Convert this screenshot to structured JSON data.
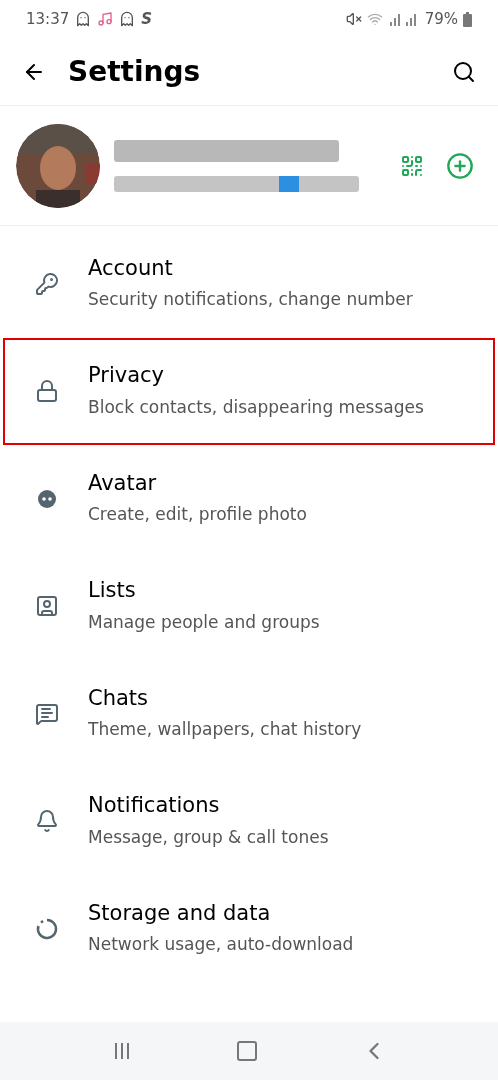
{
  "status_bar": {
    "time": "13:37",
    "notification_s": "S",
    "battery": "79%"
  },
  "header": {
    "title": "Settings"
  },
  "items": [
    {
      "kind": "key",
      "title": "Account",
      "subtitle": "Security notifications, change number",
      "highlighted": false
    },
    {
      "kind": "lock",
      "title": "Privacy",
      "subtitle": "Block contacts, disappearing messages",
      "highlighted": true
    },
    {
      "kind": "avatar",
      "title": "Avatar",
      "subtitle": "Create, edit, profile photo",
      "highlighted": false
    },
    {
      "kind": "lists",
      "title": "Lists",
      "subtitle": "Manage people and groups",
      "highlighted": false
    },
    {
      "kind": "chats",
      "title": "Chats",
      "subtitle": "Theme, wallpapers, chat history",
      "highlighted": false
    },
    {
      "kind": "bell",
      "title": "Notifications",
      "subtitle": "Message, group & call tones",
      "highlighted": false
    },
    {
      "kind": "storage",
      "title": "Storage and data",
      "subtitle": "Network usage, auto-download",
      "highlighted": false
    }
  ]
}
